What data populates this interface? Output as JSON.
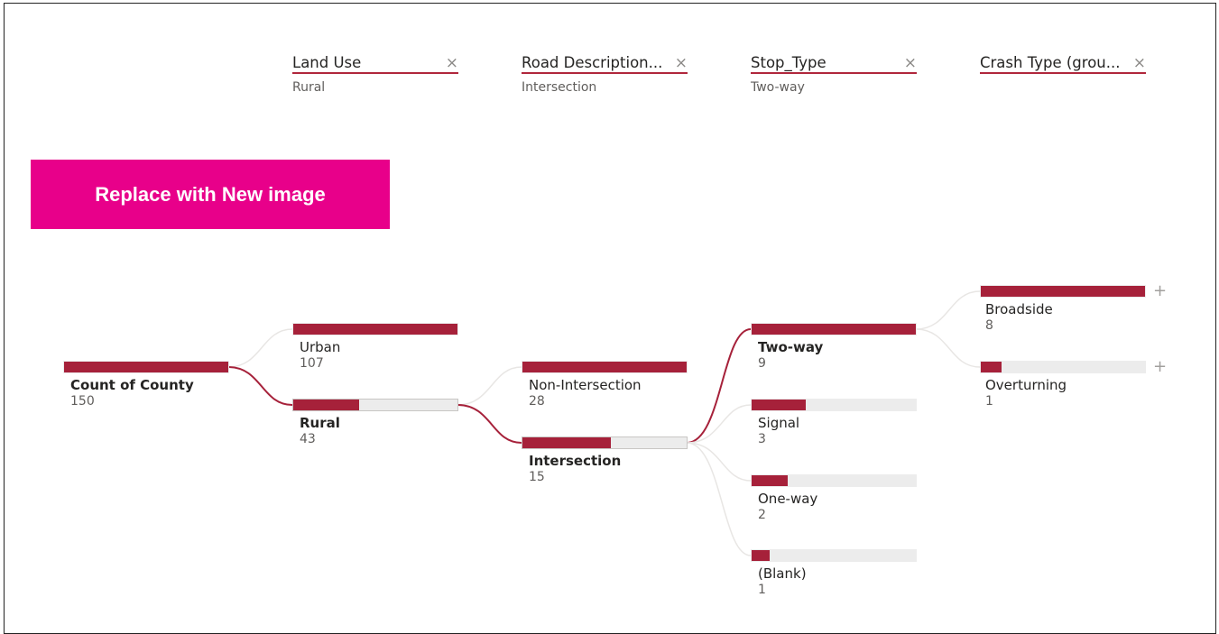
{
  "headers": [
    {
      "title": "Land Use",
      "value": "Rural"
    },
    {
      "title": "Road Description...",
      "value": "Intersection"
    },
    {
      "title": "Stop_Type",
      "value": "Two-way"
    },
    {
      "title": "Crash Type (grou...",
      "value": ""
    }
  ],
  "close_glyph": "×",
  "replace_button": "Replace with New image",
  "root": {
    "label": "Count of County",
    "value": "150",
    "fraction": 1.0
  },
  "land_use": [
    {
      "label": "Urban",
      "value": "107",
      "fraction": 1.0,
      "selected": false
    },
    {
      "label": "Rural",
      "value": "43",
      "fraction": 0.4,
      "selected": true
    }
  ],
  "road_description": [
    {
      "label": "Non-Intersection",
      "value": "28",
      "fraction": 1.0,
      "selected": false
    },
    {
      "label": "Intersection",
      "value": "15",
      "fraction": 0.54,
      "selected": true
    }
  ],
  "stop_type": [
    {
      "label": "Two-way",
      "value": "9",
      "fraction": 1.0,
      "selected": true
    },
    {
      "label": "Signal",
      "value": "3",
      "fraction": 0.33,
      "selected": false
    },
    {
      "label": "One-way",
      "value": "2",
      "fraction": 0.22,
      "selected": false
    },
    {
      "label": "(Blank)",
      "value": "1",
      "fraction": 0.11,
      "selected": false
    }
  ],
  "crash_type": [
    {
      "label": "Broadside",
      "value": "8",
      "fraction": 1.0,
      "selected": false
    },
    {
      "label": "Overturning",
      "value": "1",
      "fraction": 0.125,
      "selected": false
    }
  ],
  "expand_glyph": "+",
  "colors": {
    "bar": "#a6213a",
    "track": "#ececec",
    "accent_line": "#b0273c",
    "button": "#e8008a"
  }
}
